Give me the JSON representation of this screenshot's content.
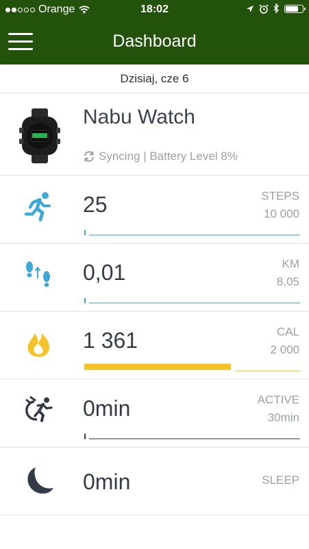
{
  "status_bar": {
    "carrier": "Orange",
    "time": "18:02",
    "signal_dots_filled": 2,
    "signal_dots_total": 5,
    "icons": [
      "wifi-icon",
      "location-arrow-icon",
      "alarm-icon",
      "bluetooth-icon",
      "battery-icon"
    ],
    "battery_level": 0.8
  },
  "navbar": {
    "title": "Dashboard",
    "menu_icon": "hamburger-menu-icon",
    "background": "#23520b"
  },
  "date_label": "Dzisiaj, cze 6",
  "device": {
    "name": "Nabu Watch",
    "sync_text": "Syncing | Battery Level 8%",
    "icon": "sync-icon"
  },
  "metrics": [
    {
      "id": "steps",
      "icon": "running-icon",
      "value": "25",
      "label": "STEPS",
      "goal": "10 000",
      "progress": 0.0025,
      "color": "#3fa9d6"
    },
    {
      "id": "km",
      "icon": "footsteps-icon",
      "value": "0,01",
      "label": "KM",
      "goal": "8,05",
      "progress": 0.0012,
      "color": "#3fa9d6"
    },
    {
      "id": "cal",
      "icon": "flame-icon",
      "value": "1 361",
      "label": "CAL",
      "goal": "2 000",
      "progress": 0.68,
      "color": "#f5c227"
    },
    {
      "id": "active",
      "icon": "active-timer-icon",
      "value": "0min",
      "label": "ACTIVE",
      "goal": "30min",
      "progress": 0,
      "color": "#343b47"
    },
    {
      "id": "sleep",
      "icon": "moon-icon",
      "value": "0min",
      "label": "SLEEP",
      "goal": "",
      "progress": null,
      "color": "#343b47"
    }
  ]
}
